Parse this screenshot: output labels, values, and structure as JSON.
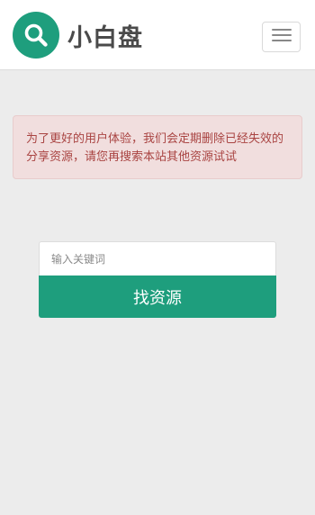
{
  "header": {
    "brand_name": "小白盘",
    "logo_icon": "search-icon",
    "menu_icon": "hamburger-menu-icon",
    "accent_color": "#1e9e7d"
  },
  "alert": {
    "message": "为了更好的用户体验，我们会定期删除已经失效的分享资源，请您再搜索本站其他资源试试"
  },
  "search": {
    "placeholder": "输入关键词",
    "value": "",
    "button_label": "找资源"
  }
}
